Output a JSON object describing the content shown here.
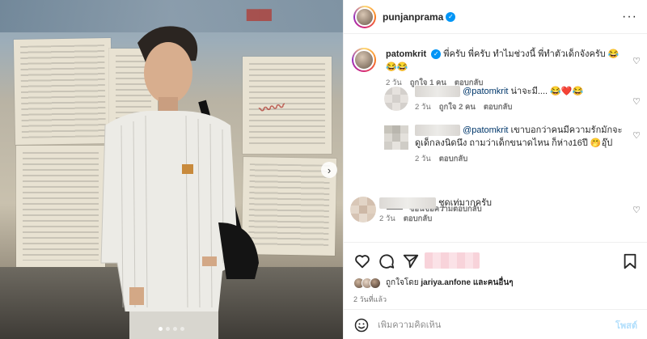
{
  "post": {
    "author": "punjanprama",
    "carousel_dots": 4,
    "carousel_active_index": 0,
    "next_icon": "chevron-right-icon",
    "more_icon": "more-horizontal-icon"
  },
  "comments": [
    {
      "username": "patomkrit",
      "verified": true,
      "text": "พี่ครับ พี่ครับ ทำไมช่วงนี้ พี่ทำตัวเด็กจังครับ 😂😂😂",
      "age": "2 วัน",
      "likes": "ถูกใจ 1 คน",
      "reply": "ตอบกลับ"
    },
    {
      "username": "",
      "mention": "@patomkrit",
      "text": " น่าจะมี.... 😂❤️😂",
      "age": "2 วัน",
      "likes": "ถูกใจ 2 คน",
      "reply": "ตอบกลับ"
    },
    {
      "username": "",
      "mention": "@patomkrit",
      "text": " เขาบอกว่าคนมีความรักมักจะดูเด็กลงนิดนึง ถามว่าเด็กขนาดไหน ก็ห่าง16ปี 🤭อุ๊ป",
      "age": "2 วัน",
      "reply": "ตอบกลับ"
    },
    {
      "username": "",
      "text": "ชุดเท่มากครับ",
      "age": "2 วัน",
      "reply": "ตอบกลับ"
    }
  ],
  "hide_replies": "ซ่อนข้อความตอบกลับ",
  "actions": {
    "like_icon": "heart-icon",
    "comment_icon": "comment-icon",
    "share_icon": "send-icon",
    "save_icon": "bookmark-icon"
  },
  "likers": {
    "prefix": "ถูกใจโดย",
    "first": "jariya.anfone",
    "suffix": "และคนอื่นๆ"
  },
  "timestamp": "2 วันที่แล้ว",
  "comment_box": {
    "placeholder": "เพิ่มความคิดเห็น",
    "post_label": "โพสต์",
    "emoji_icon": "smiley-icon"
  },
  "colors": {
    "accent": "#0095f6",
    "mention": "#00376b",
    "secondary_text": "#737373",
    "post_disabled": "#b2dffc"
  }
}
